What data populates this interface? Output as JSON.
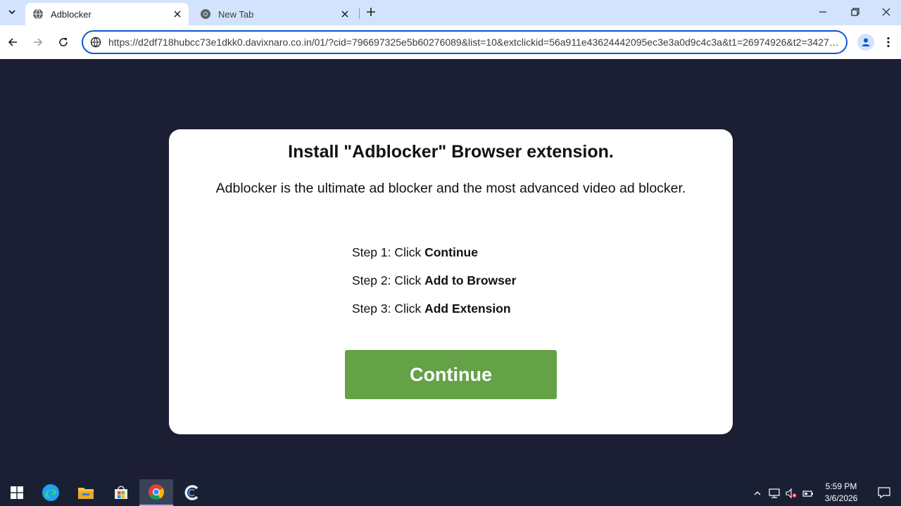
{
  "browser": {
    "tabs": [
      {
        "title": "Adblocker",
        "icon": "globe-icon",
        "active": true
      },
      {
        "title": "New Tab",
        "icon": "chrome-icon",
        "active": false
      }
    ],
    "address": {
      "url": "https://d2df718hubcc73e1dkk0.davixnaro.co.in/01/?cid=796697325e5b60276089&list=10&extclickid=56a911e43624442095ec3e3a0d9c4c3a&t1=26974926&t2=3427…"
    },
    "accent_color": "#0b57d0"
  },
  "page": {
    "heading": "Install \"Adblocker\" Browser extension.",
    "subtitle": "Adblocker is the ultimate ad blocker and the most advanced video ad blocker.",
    "steps": [
      {
        "prefix": "Step 1: Click ",
        "action": "Continue"
      },
      {
        "prefix": "Step 2: Click ",
        "action": "Add to Browser"
      },
      {
        "prefix": "Step 3: Click ",
        "action": "Add Extension"
      }
    ],
    "continue_label": "Continue",
    "button_color": "#65a147",
    "background_color": "#1c1e33"
  },
  "taskbar": {
    "apps": [
      "windows-start-icon",
      "edge-icon",
      "file-explorer-icon",
      "store-icon",
      "chrome-icon",
      "ccleaner-icon"
    ],
    "clock": {
      "time": "5:59 PM",
      "date": "3/6/2026"
    }
  }
}
